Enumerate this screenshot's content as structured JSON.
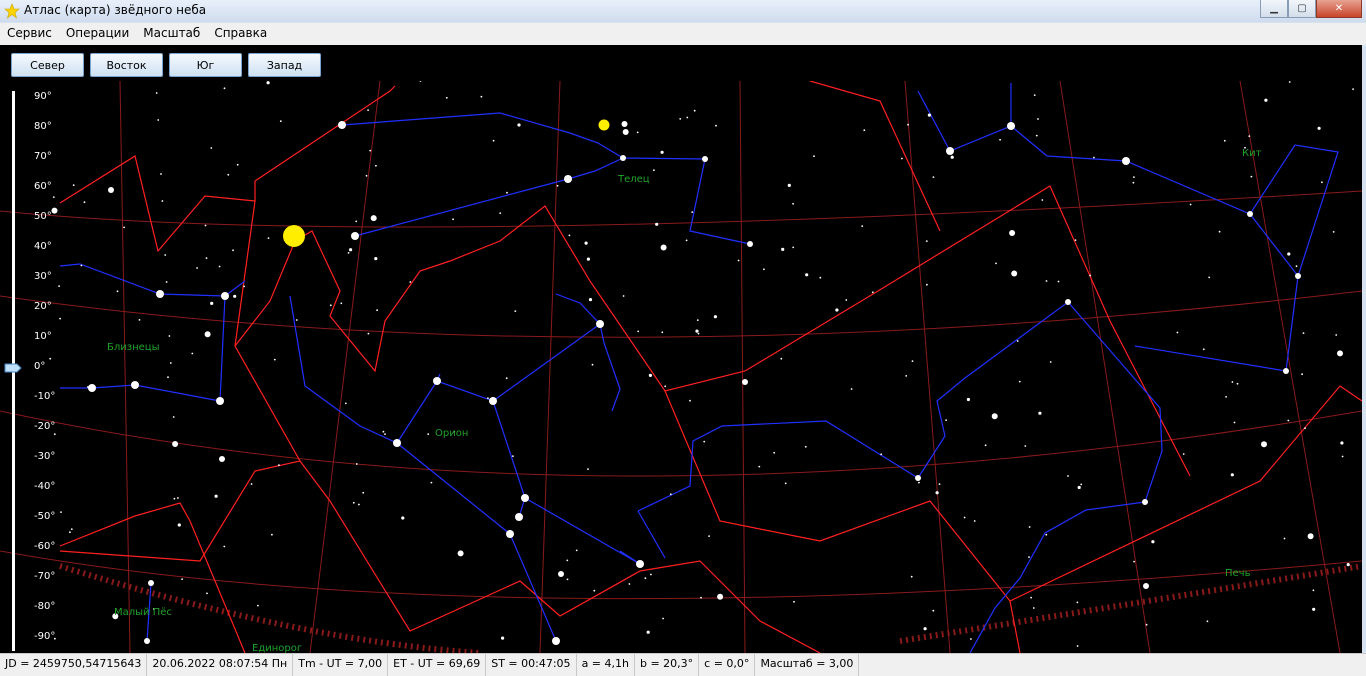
{
  "window": {
    "title": "Атлас (карта) звёдного неба"
  },
  "menu": [
    "Сервис",
    "Операции",
    "Масштаб",
    "Справка"
  ],
  "directions": [
    "Север",
    "Восток",
    "Юг",
    "Запад"
  ],
  "declination_labels": [
    "90°",
    "80°",
    "70°",
    "60°",
    "50°",
    "40°",
    "30°",
    "20°",
    "10°",
    "0°",
    "-10°",
    "-20°",
    "-30°",
    "-40°",
    "-50°",
    "-60°",
    "-70°",
    "-80°",
    "-90°"
  ],
  "constellations": [
    "Телец",
    "Кит",
    "Близнецы",
    "Орион",
    "Малый Пёс",
    "Печь",
    "Единорог"
  ],
  "status": {
    "jd": "JD = 2459750,54715643",
    "datetime": "20.06.2022 08:07:54 Пн",
    "tm_ut": "Tm - UT = 7,00",
    "et_ut": "ET - UT = 69,69",
    "st": "ST = 00:47:05",
    "a": "a = 4,1h",
    "b": "b = 20,3°",
    "c": "c = 0,0°",
    "scale": "Масштаб = 3,00"
  },
  "colors": {
    "sky": "#000000",
    "boundary": "#ff2020",
    "figure": "#2030ff",
    "grid": "#8a1a1a",
    "label": "#1fa32a",
    "sun": "#ffee00"
  }
}
